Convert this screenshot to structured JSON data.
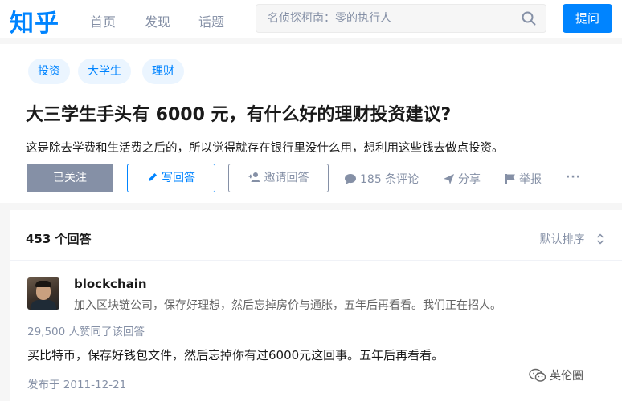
{
  "header": {
    "logo": "知乎",
    "nav": [
      "首页",
      "发现",
      "话题"
    ],
    "search_placeholder": "名侦探柯南：零的执行人",
    "ask_label": "提问",
    "accent_color": "#0084ff"
  },
  "question": {
    "tags": [
      "投资",
      "大学生",
      "理财"
    ],
    "title": "大三学生手头有 6000 元，有什么好的理财投资建议?",
    "description": "这是除去学费和生活费之后的，所以觉得就存在银行里没什么用，想利用这些钱去做点投资。",
    "actions": {
      "follow": "已关注",
      "write": "写回答",
      "invite": "邀请回答",
      "comments": "185 条评论",
      "share": "分享",
      "report": "举报",
      "more": "···"
    }
  },
  "answers": {
    "count_label": "453 个回答",
    "sort_label": "默认排序",
    "items": [
      {
        "author": "blockchain",
        "bio": "加入区块链公司，保存好理想，然后忘掉房价与通胀，五年后再看看。我们正在招人。",
        "votes": "29,500 人赞同了该回答",
        "content": "买比特币，保存好钱包文件，然后忘掉你有过6000元这回事。五年后再看看。",
        "published": "发布于 2011-12-21"
      }
    ]
  },
  "watermark": "英伦圈"
}
